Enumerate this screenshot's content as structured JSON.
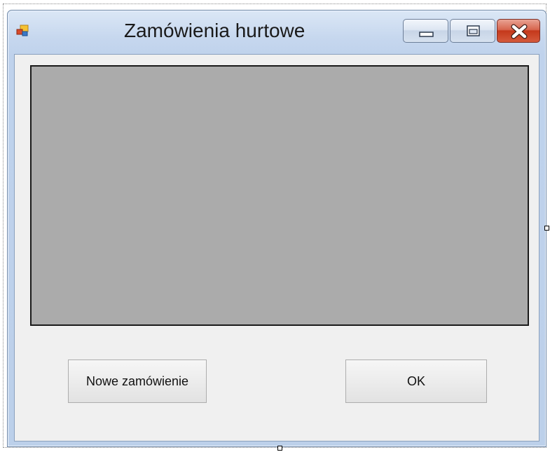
{
  "window": {
    "title": "Zamówienia hurtowe",
    "icon": "app-window-icon",
    "caption_buttons": {
      "minimize": "minimize-icon",
      "maximize": "maximize-icon",
      "close": "close-icon"
    }
  },
  "main": {
    "panel_color": "#ababab"
  },
  "buttons": {
    "new_order_label": "Nowe zamówienie",
    "ok_label": "OK"
  },
  "colors": {
    "close_button": "#c4381b",
    "client_background": "#f0f0f0",
    "titlebar": "#c6d7ee"
  }
}
